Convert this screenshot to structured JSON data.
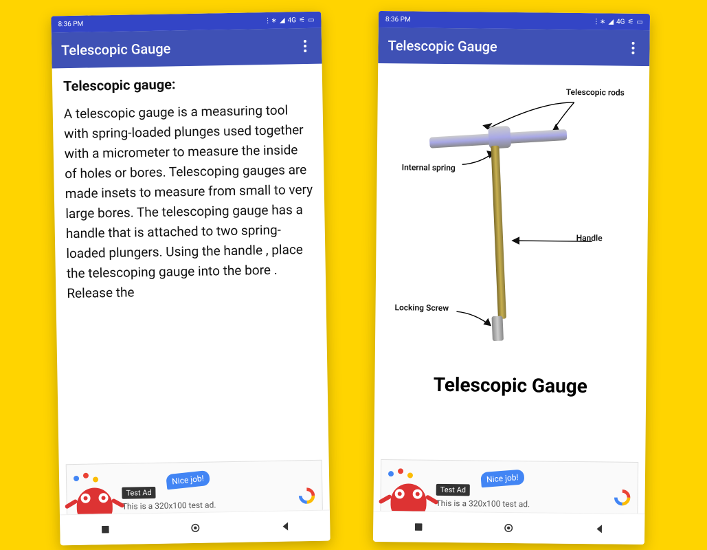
{
  "colors": {
    "accent": "#3f51b5",
    "sysbar": "#3345c6",
    "bg": "#ffd400",
    "ad_blue": "#4285f4"
  },
  "sysbar": {
    "time": "8:36 PM",
    "net_label": "4G",
    "icons": [
      "bluetooth",
      "signal",
      "wifi",
      "battery"
    ]
  },
  "appbar": {
    "title": "Telescopic Gauge"
  },
  "screen_left": {
    "heading": "Telescopic gauge:",
    "body": " A telescopic gauge is a measuring tool with spring-loaded plunges used together with a micrometer to measure the inside of holes or bores. Telescoping gauges are made insets to measure from small to very large bores. The telescoping gauge has a handle that is attached to two spring-loaded plungers. Using the handle , place the telescoping gauge into the bore . Release the"
  },
  "screen_right": {
    "caption": "Telescopic Gauge",
    "labels": {
      "telescopic_rods": "Telescopic rods",
      "internal_spring": "Internal spring",
      "handle": "Handle",
      "locking_screw": "Locking Screw"
    }
  },
  "ad": {
    "badge": "Test Ad",
    "bubble": "Nice job!",
    "desc": "This is a 320x100 test ad."
  },
  "nav": {
    "recent": "recent",
    "home": "home",
    "back": "back"
  }
}
